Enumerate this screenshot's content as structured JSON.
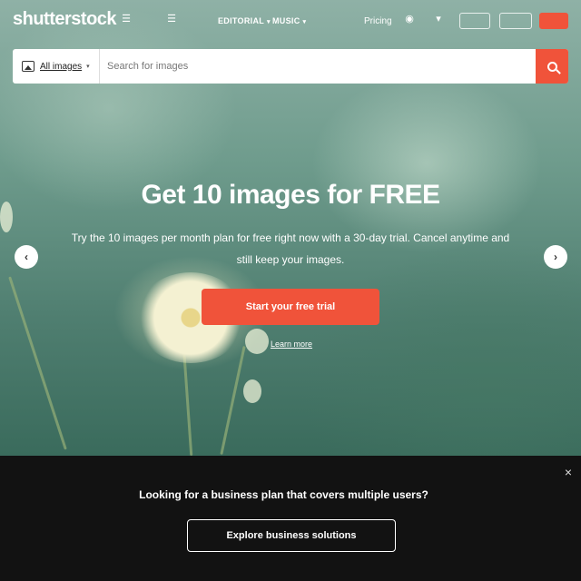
{
  "header": {
    "logo": "shutterstock",
    "nav": [
      {
        "label": "EDITORIAL",
        "chev": "▾"
      },
      {
        "label": "MUSIC",
        "chev": "▾"
      }
    ],
    "pricing": "Pricing"
  },
  "search": {
    "type_label": "All images",
    "type_chev": "▾",
    "placeholder": "Search for images"
  },
  "hero": {
    "title": "Get 10 images for FREE",
    "subtitle": "Try the 10 images per month plan for free right now with a 30-day trial. Cancel anytime and still keep your images.",
    "cta": "Start your free trial",
    "learn_more": "Learn more",
    "prev": "‹",
    "next": "›"
  },
  "business_banner": {
    "title": "Looking for a business plan that covers multiple users?",
    "button": "Explore business solutions",
    "close": "×"
  },
  "colors": {
    "accent": "#f0533a",
    "banner_bg": "#121212"
  }
}
